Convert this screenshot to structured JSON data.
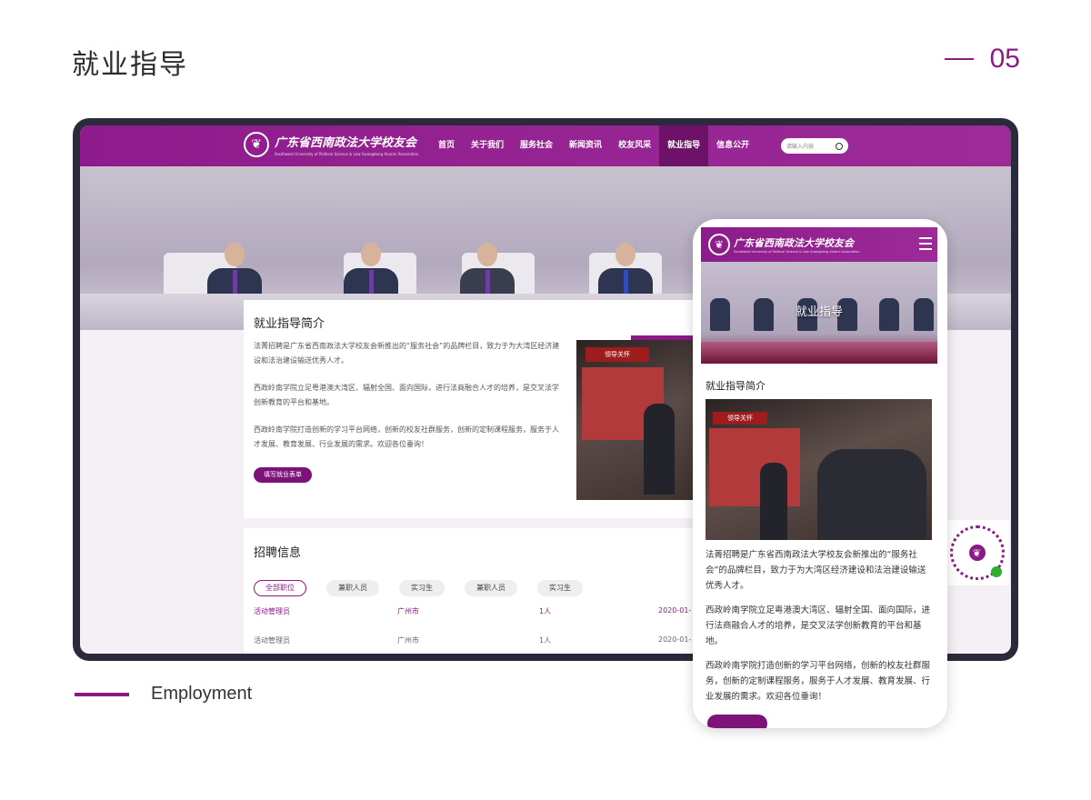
{
  "slide": {
    "title": "就业指导",
    "page_number": "05",
    "footer_label": "Employment"
  },
  "desktop": {
    "logo_text": "广东省西南政法大学校友会",
    "logo_sub": "Southwest University of Political Science & Law Guangdong Alumni Association",
    "nav": [
      "首页",
      "关于我们",
      "服务社会",
      "新闻资讯",
      "校友风采",
      "就业指导",
      "信息公开"
    ],
    "nav_active_index": 5,
    "search_placeholder": "请输入内容",
    "intro": {
      "title": "就业指导简介",
      "paragraphs": [
        "法菁招聘是广东省西南政法大学校友会新推出的“服务社会”的品牌栏目，致力于为大湾区经济建设和法治建设输送优秀人才。",
        "西政岭南学院立足粤港澳大湾区、辐射全国、面向国际，进行法商融合人才的培养，是交叉法学创新教育的平台和基地。",
        "西政岭南学院打造创新的学习平台网络，创新的校友社群服务，创新的定制课程服务，服务于人才发展、教育发展、行业发展的需求。欢迎各位垂询！"
      ],
      "button": "填写就业表单",
      "photo_banner": "领导关怀"
    },
    "jobs": {
      "title": "招聘信息",
      "filters": [
        "全部职位",
        "兼职人员",
        "实习生",
        "兼职人员",
        "实习生"
      ],
      "rows": [
        {
          "position": "活动管理员",
          "city": "广州市",
          "count": "1人",
          "date": "2020-01-"
        },
        {
          "position": "活动管理员",
          "city": "广州市",
          "count": "1人",
          "date": "2020-01-"
        }
      ]
    }
  },
  "mobile": {
    "logo_text": "广东省西南政法大学校友会",
    "logo_sub": "Southwest University of Political Science & Law Guangdong Alumni Association",
    "hero_title": "就业指导",
    "section_title": "就业指导简介",
    "photo_banner": "领导关怀",
    "paragraphs": [
      "法菁招聘是广东省西南政法大学校友会新推出的“服务社会”的品牌栏目，致力于为大湾区经济建设和法治建设输送优秀人才。",
      "西政岭南学院立足粤港澳大湾区、辐射全国、面向国际，进行法商融合人才的培养，是交叉法学创新教育的平台和基地。",
      "西政岭南学院打造创新的学习平台网络，创新的校友社群服务，创新的定制课程服务，服务于人才发展、教育发展、行业发展的需求。欢迎各位垂询！"
    ]
  },
  "colors": {
    "brand": "#8a1a86",
    "brand_dark": "#6e1269"
  },
  "icons": [
    "logo-emblem-icon",
    "search-icon",
    "menu-icon",
    "qr-code-icon"
  ]
}
